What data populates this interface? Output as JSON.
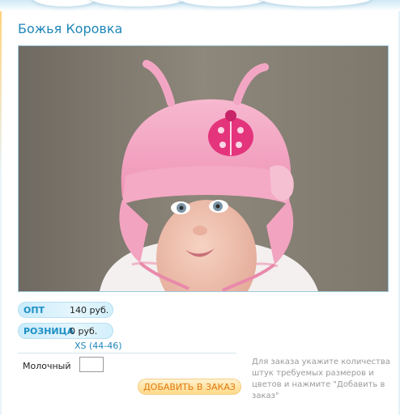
{
  "product": {
    "title": "Божья Коровка",
    "photo_icon": "product-photo"
  },
  "prices": {
    "wholesale_label": "ОПТ",
    "wholesale_value": "140 руб.",
    "retail_label": "РОЗНИЦА",
    "retail_value": "0 руб."
  },
  "size": {
    "label": "XS (44-46)"
  },
  "colors": [
    {
      "name": "Молочный",
      "quantity": ""
    }
  ],
  "actions": {
    "add_to_order": "ДОБАВИТЬ В ЗАКАЗ"
  },
  "hint": "Для заказа укажите количества штук требуемых размеров и цветов и нажмите \"Добавить в заказ\"",
  "palette": {
    "title": "#1f86b8",
    "pill_label": "#1d8fc4",
    "button_text": "#e07a12",
    "hint_text": "#9a9a9a"
  }
}
